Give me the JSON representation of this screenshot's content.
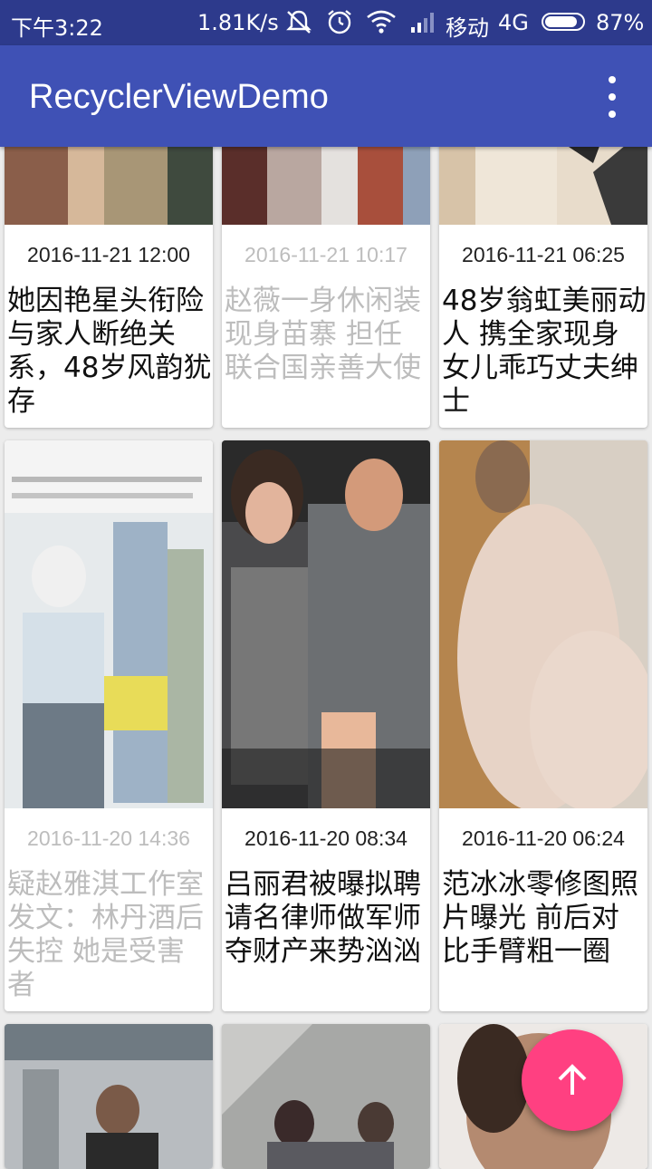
{
  "status_bar": {
    "time": "下午3:22",
    "speed": "1.81K/s",
    "carrier": "移动",
    "network": "4G",
    "battery": "87%",
    "battery_level": 0.87,
    "icons": [
      "mute-icon",
      "alarm-icon",
      "wifi-icon",
      "signal-icon"
    ]
  },
  "app_bar": {
    "title": "RecyclerViewDemo",
    "menu_icon": "overflow-menu-icon"
  },
  "cards": [
    {
      "date": "2016-11-21 12:00",
      "title": "她因艳星头衔险与家人断绝关系，48岁风韵犹存",
      "dim": false
    },
    {
      "date": "2016-11-21 10:17",
      "title": "赵薇一身休闲装现身苗寨 担任联合国亲善大使",
      "dim": true
    },
    {
      "date": "2016-11-21 06:25",
      "title": "48岁翁虹美丽动人 携全家现身女儿乖巧丈夫绅士",
      "dim": false
    },
    {
      "date": "2016-11-20 14:36",
      "title": "疑赵雅淇工作室发文：林丹酒后失控 她是受害者",
      "dim": true
    },
    {
      "date": "2016-11-20 08:34",
      "title": "吕丽君被曝拟聘请名律师做军师夺财产来势汹汹",
      "dim": false
    },
    {
      "date": "2016-11-20 06:24",
      "title": "范冰冰零修图照片曝光 前后对比手臂粗一圈",
      "dim": false
    }
  ],
  "fab": {
    "icon": "arrow-up-icon",
    "color": "#ff4081"
  },
  "colors": {
    "primary": "#3f51b5",
    "primary_dark": "#2d3a8c",
    "accent": "#ff4081"
  }
}
